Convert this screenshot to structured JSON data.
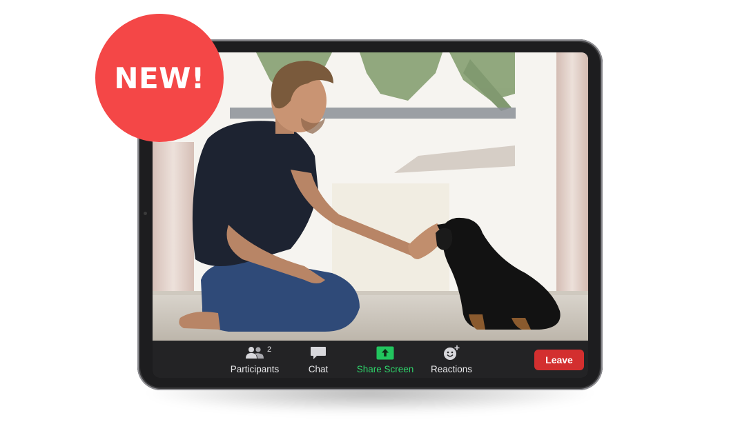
{
  "badge": {
    "text": "NEW!",
    "color": "#f44747"
  },
  "video": {
    "scene": "video-feed"
  },
  "toolbar": {
    "participants": {
      "label": "Participants",
      "count": "2",
      "icon": "participants-icon"
    },
    "chat": {
      "label": "Chat",
      "icon": "chat-icon"
    },
    "share_screen": {
      "label": "Share Screen",
      "icon": "share-screen-icon",
      "color": "#2ed36a"
    },
    "reactions": {
      "label": "Reactions",
      "icon": "reactions-icon"
    },
    "leave": {
      "label": "Leave",
      "color": "#d32f2f"
    }
  }
}
